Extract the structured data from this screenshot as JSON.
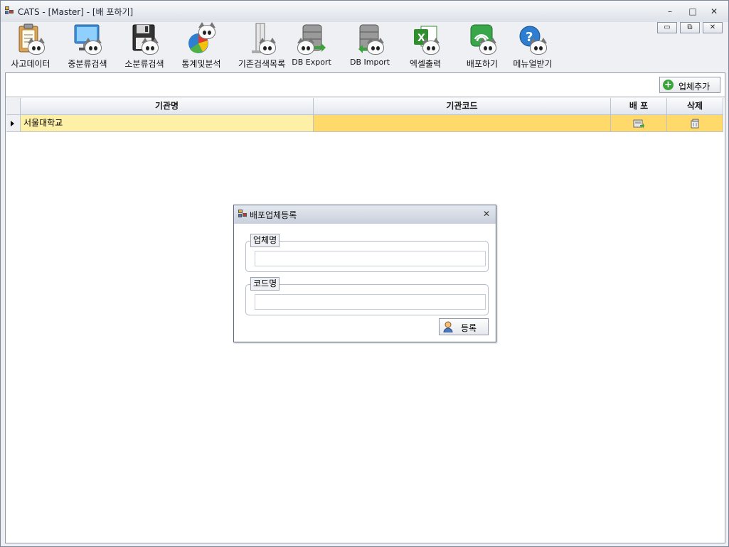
{
  "window": {
    "title": "CATS - [Master] - [배 포하기]",
    "controls": {
      "minimize": "▭",
      "restore": "⧉",
      "close": "✕"
    }
  },
  "toolbar": {
    "items": [
      {
        "label": "사고데이터",
        "icon": "clipboard-cat-icon"
      },
      {
        "label": "중분류검색",
        "icon": "monitor-cat-icon"
      },
      {
        "label": "소분류검색",
        "icon": "floppy-cat-icon"
      },
      {
        "label": "통계및분석",
        "icon": "pie-chart-cat-icon"
      },
      {
        "label": "기존검색목록",
        "icon": "document-list-cat-icon"
      },
      {
        "label": "DB Export",
        "icon": "db-export-cat-icon"
      },
      {
        "label": "DB Import",
        "icon": "db-import-cat-icon"
      },
      {
        "label": "엑셀출력",
        "icon": "excel-cat-icon"
      },
      {
        "label": "배포하기",
        "icon": "wifi-cat-icon"
      },
      {
        "label": "메뉴얼받기",
        "icon": "help-cat-icon"
      }
    ]
  },
  "action_bar": {
    "add_company_label": "업체추가"
  },
  "grid": {
    "columns": [
      "기관명",
      "기관코드",
      "배 포",
      "삭제"
    ],
    "rows": [
      {
        "name": "서울대학교",
        "code": ""
      }
    ]
  },
  "dialog": {
    "title": "배포업체등록",
    "company_name_label": "업체명",
    "company_name_value": "",
    "code_name_label": "코드명",
    "code_name_value": "",
    "register_label": "등록"
  },
  "colors": {
    "selected_row": "#ffd969",
    "selected_first_cell": "#fff0a8",
    "window_bg": "#eef0f4"
  }
}
